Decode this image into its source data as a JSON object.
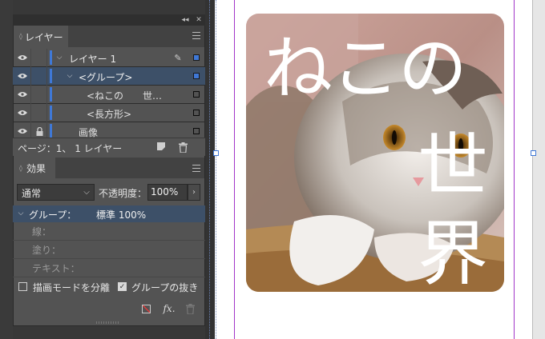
{
  "layers_panel": {
    "tab": "レイヤー",
    "rows": [
      {
        "label": "レイヤー 1"
      },
      {
        "label": "<グループ>"
      },
      {
        "label": "<ねこの　　世…"
      },
      {
        "label": "<長方形>"
      },
      {
        "label": "画像"
      }
    ],
    "footer": "ページ：1、 1 レイヤー"
  },
  "effects_panel": {
    "tab": "効果",
    "blend_mode": "通常",
    "opacity_label": "不透明度：",
    "opacity_value": "100%",
    "target_label": "グループ：",
    "target_value": "標準 100%",
    "subrows": [
      "線：",
      "塗り：",
      "テキスト："
    ],
    "isolate_label": "描画モードを分離",
    "knockout_label": "グループの抜き"
  },
  "canvas": {
    "title_line1": "ねこの",
    "title_col": [
      "世",
      "界"
    ]
  },
  "colors": {
    "accent": "#3f78d6",
    "selected_row": "#3d5068",
    "frame": "#a235c9"
  }
}
